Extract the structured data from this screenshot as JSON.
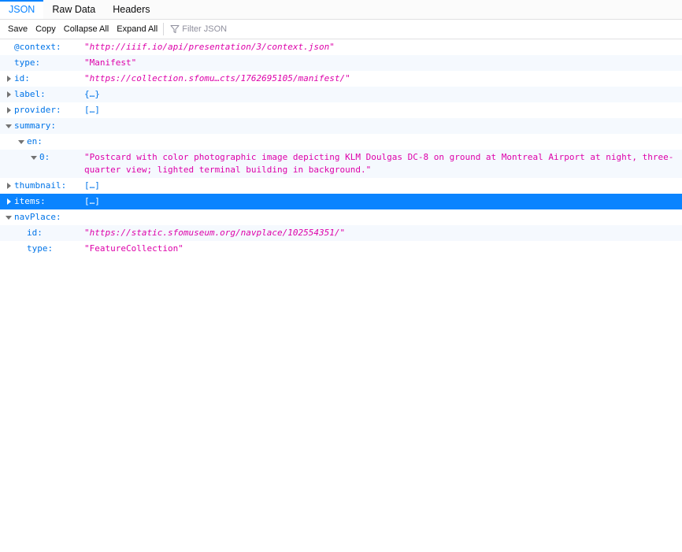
{
  "tabs": [
    {
      "label": "JSON",
      "active": true
    },
    {
      "label": "Raw Data",
      "active": false
    },
    {
      "label": "Headers",
      "active": false
    }
  ],
  "toolbar": {
    "save": "Save",
    "copy": "Copy",
    "collapse_all": "Collapse All",
    "expand_all": "Expand All",
    "filter_placeholder": "Filter JSON"
  },
  "colors": {
    "accent": "#0a84ff",
    "key": "#0074e8",
    "string": "#dd00a9",
    "selected_bg": "#0a84ff"
  },
  "icons": {
    "filter": "funnel-icon",
    "expanded": "triangle-down-icon",
    "collapsed": "triangle-right-icon"
  },
  "rows": [
    {
      "key": "@context:",
      "value": "\"http://iiif.io/api/presentation/3/context.json\"",
      "depth": 0,
      "twisty": "none",
      "italic": true
    },
    {
      "key": "type:",
      "value": "\"Manifest\"",
      "depth": 0,
      "twisty": "none",
      "italic": false
    },
    {
      "key": "id:",
      "value": "\"https://collection.sfomu…cts/1762695105/manifest/\"",
      "depth": 0,
      "twisty": "closed",
      "italic": true
    },
    {
      "key": "label:",
      "value": "{…}",
      "depth": 0,
      "twisty": "closed",
      "obj": true
    },
    {
      "key": "provider:",
      "value": "[…]",
      "depth": 0,
      "twisty": "closed",
      "obj": true
    },
    {
      "key": "summary:",
      "value": "",
      "depth": 0,
      "twisty": "open"
    },
    {
      "key": "en:",
      "value": "",
      "depth": 1,
      "twisty": "open"
    },
    {
      "key": "0:",
      "value": "\"Postcard with color photographic image depicting KLM Doulgas DC-8 on ground at Montreal Airport at night, three-quarter view; lighted terminal building in background.\"",
      "depth": 2,
      "twisty": "open",
      "italic": false
    },
    {
      "key": "thumbnail:",
      "value": "[…]",
      "depth": 0,
      "twisty": "closed",
      "obj": true
    },
    {
      "key": "items:",
      "value": "[…]",
      "depth": 0,
      "twisty": "closed",
      "obj": true,
      "selected": true
    },
    {
      "key": "navPlace:",
      "value": "",
      "depth": 0,
      "twisty": "open"
    },
    {
      "key": "id:",
      "value": "\"https://static.sfomuseum.org/navplace/102554351/\"",
      "depth": 1,
      "twisty": "none",
      "italic": true
    },
    {
      "key": "type:",
      "value": "\"FeatureCollection\"",
      "depth": 1,
      "twisty": "none",
      "italic": false
    }
  ]
}
